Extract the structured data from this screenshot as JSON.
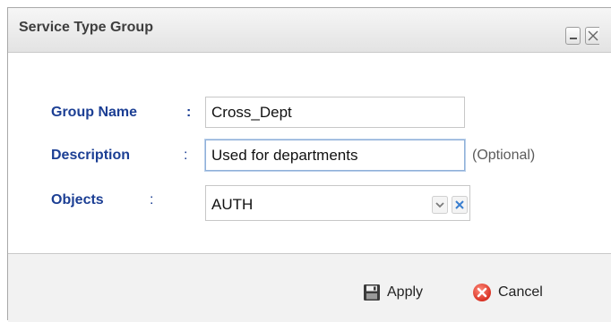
{
  "dialog": {
    "title": "Service Type Group",
    "buttons": {
      "minimize_icon": "minimize-icon",
      "close_icon": "close-icon"
    }
  },
  "form": {
    "group_name": {
      "label": "Group Name",
      "colon": ":",
      "value": "Cross_Dept"
    },
    "description": {
      "label": "Description",
      "colon": ":",
      "value": "Used for departments",
      "hint": "(Optional)"
    },
    "objects": {
      "label": "Objects",
      "colon": ":",
      "value": "AUTH",
      "dropdown_icon": "chevron-down-icon",
      "clear_icon": "clear-x-icon"
    }
  },
  "footer": {
    "apply_label": "Apply",
    "apply_icon": "save-icon",
    "cancel_label": "Cancel",
    "cancel_icon": "cancel-icon"
  },
  "colors": {
    "label": "#1c3f94",
    "clear_icon": "#3a7fd0",
    "cancel_icon": "#d93b2b"
  }
}
